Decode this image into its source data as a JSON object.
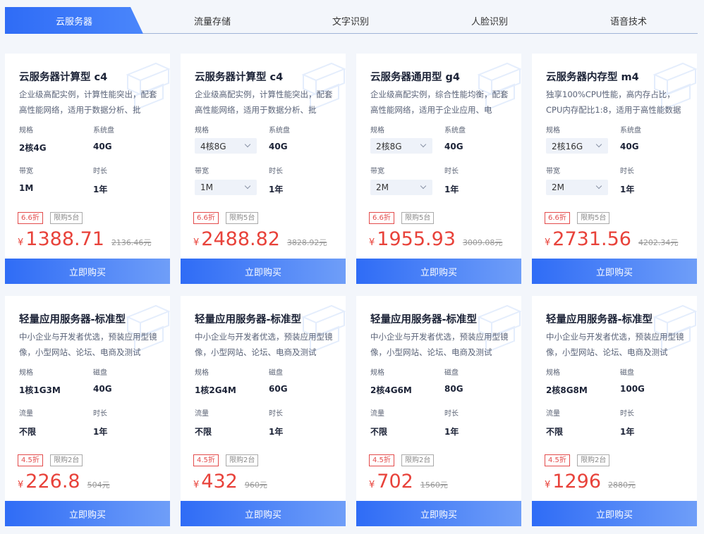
{
  "tabs": [
    {
      "label": "云服务器"
    },
    {
      "label": "流量存储"
    },
    {
      "label": "文字识别"
    },
    {
      "label": "人脸识别"
    },
    {
      "label": "语音技术"
    }
  ],
  "buy_label": "立即购买",
  "cards": [
    {
      "title": "云服务器计算型 c4",
      "desc": "企业级高配实例，计算性能突出，配套高性能网络，适用于数据分析、批",
      "spec_label": "规格",
      "spec": "2核4G",
      "disk_label": "系统盘",
      "disk": "40G",
      "bw_label": "带宽",
      "bw": "1M",
      "dur_label": "时长",
      "dur": "1年",
      "discount": "6.6折",
      "limit": "限购5台",
      "currency": "¥",
      "price": "1388.71",
      "orig": "2136.46元"
    },
    {
      "title": "云服务器计算型 c4",
      "desc": "企业级高配实例，计算性能突出，配套高性能网络，适用于数据分析、批",
      "spec_label": "规格",
      "spec": "4核8G",
      "disk_label": "系统盘",
      "disk": "40G",
      "bw_label": "带宽",
      "bw": "1M",
      "dur_label": "时长",
      "dur": "1年",
      "discount": "6.6折",
      "limit": "限购5台",
      "currency": "¥",
      "price": "2488.82",
      "orig": "3828.92元"
    },
    {
      "title": "云服务器通用型 g4",
      "desc": "企业级高配实例，综合性能均衡，配套高性能网络，适用于企业应用、电",
      "spec_label": "规格",
      "spec": "2核8G",
      "disk_label": "系统盘",
      "disk": "40G",
      "bw_label": "带宽",
      "bw": "2M",
      "dur_label": "时长",
      "dur": "1年",
      "discount": "6.6折",
      "limit": "限购5台",
      "currency": "¥",
      "price": "1955.93",
      "orig": "3009.08元"
    },
    {
      "title": "云服务器内存型 m4",
      "desc": "独享100%CPU性能，高内存占比，CPU内存配比1:8，适用于高性能数据",
      "spec_label": "规格",
      "spec": "2核16G",
      "disk_label": "系统盘",
      "disk": "40G",
      "bw_label": "带宽",
      "bw": "2M",
      "dur_label": "时长",
      "dur": "1年",
      "discount": "6.6折",
      "limit": "限购5台",
      "currency": "¥",
      "price": "2731.56",
      "orig": "4202.34元"
    },
    {
      "title": "轻量应用服务器-标准型",
      "desc": "中小企业与开发者优选，预装应用型镜像，小型网站、论坛、电商及测试",
      "spec_label": "规格",
      "spec": "1核1G3M",
      "disk_label": "磁盘",
      "disk": "40G",
      "bw_label": "流量",
      "bw": "不限",
      "dur_label": "时长",
      "dur": "1年",
      "discount": "4.5折",
      "limit": "限购2台",
      "currency": "¥",
      "price": "226.8",
      "orig": "504元"
    },
    {
      "title": "轻量应用服务器-标准型",
      "desc": "中小企业与开发者优选，预装应用型镜像，小型网站、论坛、电商及测试",
      "spec_label": "规格",
      "spec": "1核2G4M",
      "disk_label": "磁盘",
      "disk": "60G",
      "bw_label": "流量",
      "bw": "不限",
      "dur_label": "时长",
      "dur": "1年",
      "discount": "4.5折",
      "limit": "限购2台",
      "currency": "¥",
      "price": "432",
      "orig": "960元"
    },
    {
      "title": "轻量应用服务器-标准型",
      "desc": "中小企业与开发者优选，预装应用型镜像，小型网站、论坛、电商及测试",
      "spec_label": "规格",
      "spec": "2核4G6M",
      "disk_label": "磁盘",
      "disk": "80G",
      "bw_label": "流量",
      "bw": "不限",
      "dur_label": "时长",
      "dur": "1年",
      "discount": "4.5折",
      "limit": "限购2台",
      "currency": "¥",
      "price": "702",
      "orig": "1560元"
    },
    {
      "title": "轻量应用服务器-标准型",
      "desc": "中小企业与开发者优选，预装应用型镜像，小型网站、论坛、电商及测试",
      "spec_label": "规格",
      "spec": "2核8G8M",
      "disk_label": "磁盘",
      "disk": "100G",
      "bw_label": "流量",
      "bw": "不限",
      "dur_label": "时长",
      "dur": "1年",
      "discount": "4.5折",
      "limit": "限购2台",
      "currency": "¥",
      "price": "1296",
      "orig": "2880元"
    }
  ]
}
